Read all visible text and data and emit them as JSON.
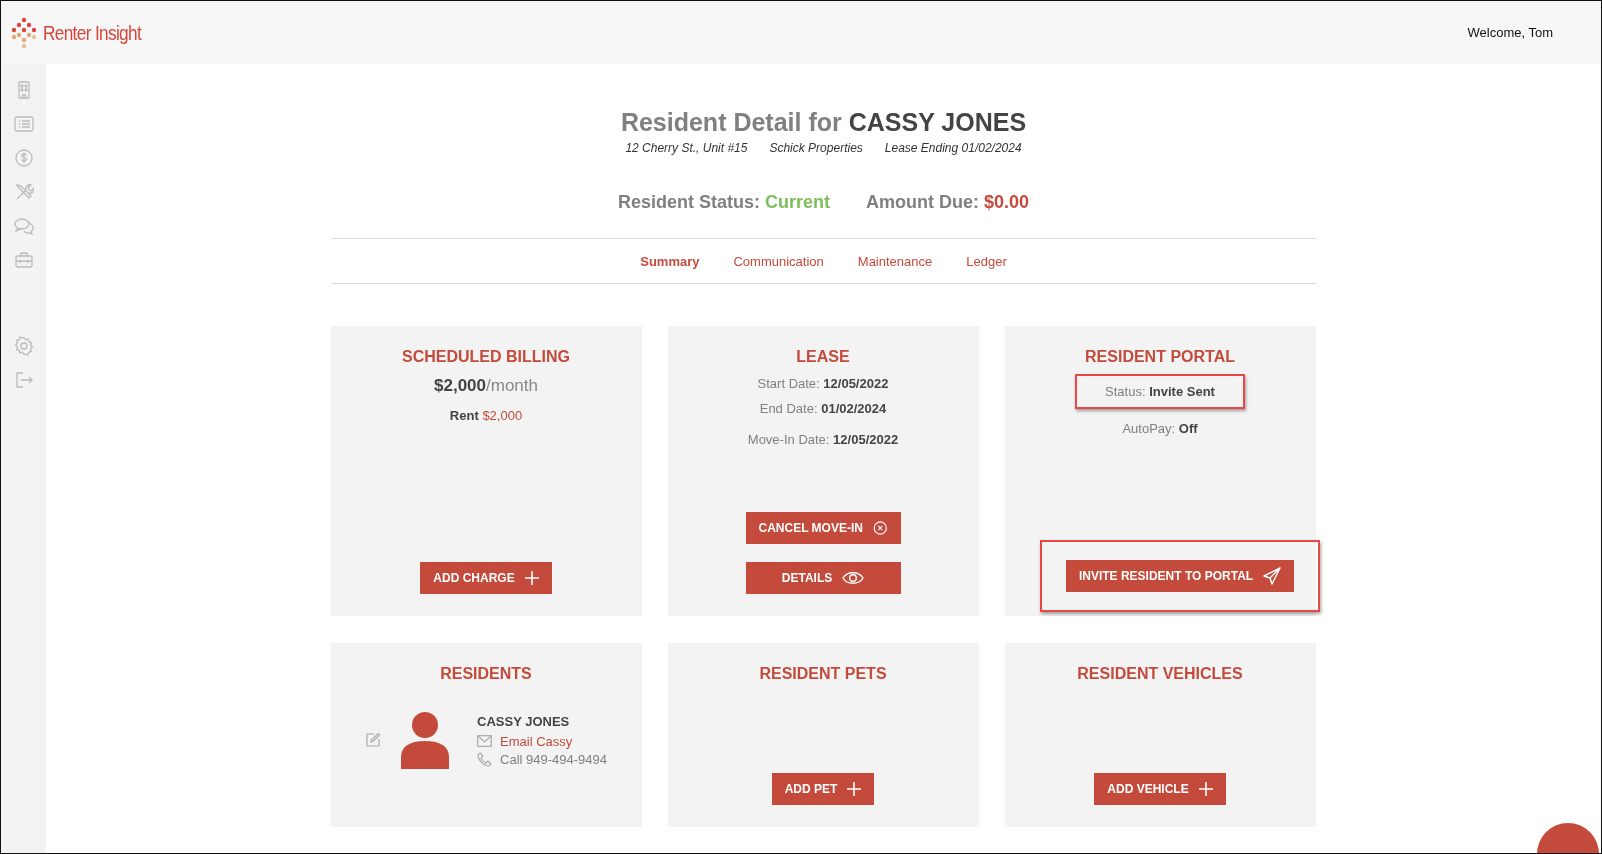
{
  "header": {
    "brand": "Renter Insight",
    "welcome": "Welcome, Tom"
  },
  "resident": {
    "title_prefix": "Resident Detail for",
    "name": "CASSY JONES",
    "details": [
      "12 Cherry St., Unit #15",
      "Schick Properties",
      "Lease Ending 01/02/2024"
    ],
    "status_label": "Resident Status:",
    "status": "Current",
    "amount_label": "Amount Due:",
    "amount": "$0.00"
  },
  "tabs": [
    {
      "label": "Summary",
      "selected": true
    },
    {
      "label": "Communication",
      "selected": false
    },
    {
      "label": "Maintenance",
      "selected": false
    },
    {
      "label": "Ledger",
      "selected": false
    }
  ],
  "cards": [
    {
      "kind": "billing",
      "title": "SCHEDULED BILLING",
      "amount": "$2,000",
      "period": "/month",
      "charges": [
        {
          "label": "Rent",
          "amount": "$2,000"
        }
      ],
      "buttons": [
        {
          "label": "ADD CHARGE",
          "highlighted": false
        }
      ]
    },
    {
      "kind": "lease",
      "title": "LEASE",
      "field_groups": [
        [
          {
            "label": "Start Date:",
            "value": "12/05/2022",
            "highlighted": false
          },
          {
            "label": "End Date:",
            "value": "01/02/2024",
            "highlighted": false
          }
        ],
        [
          {
            "label": "Move-In Date:",
            "value": "12/05/2022",
            "highlighted": false
          }
        ]
      ],
      "buttons": [
        {
          "label": "CANCEL MOVE-IN",
          "highlighted": false
        },
        {
          "label": "DETAILS",
          "highlighted": false
        }
      ]
    },
    {
      "kind": "portal",
      "title": "RESIDENT PORTAL",
      "field_groups": [
        [
          {
            "label": "Status:",
            "value": "Invite Sent",
            "highlighted": true
          }
        ],
        [
          {
            "label": "AutoPay:",
            "value": "Off",
            "highlighted": false
          }
        ]
      ],
      "buttons": [
        {
          "label": "INVITE RESIDENT TO PORTAL",
          "highlighted": true
        }
      ]
    },
    {
      "kind": "residents",
      "title": "RESIDENTS",
      "residents": [
        {
          "name": "CASSY JONES",
          "email": "Email Cassy",
          "phone": "Call 949-494-9494"
        }
      ]
    },
    {
      "kind": "pets",
      "title": "RESIDENT PETS",
      "buttons": [
        {
          "label": "ADD PET",
          "highlighted": false
        }
      ]
    },
    {
      "kind": "vehicles",
      "title": "RESIDENT VEHICLES",
      "buttons": [
        {
          "label": "ADD VEHICLE",
          "highlighted": false
        }
      ]
    }
  ]
}
